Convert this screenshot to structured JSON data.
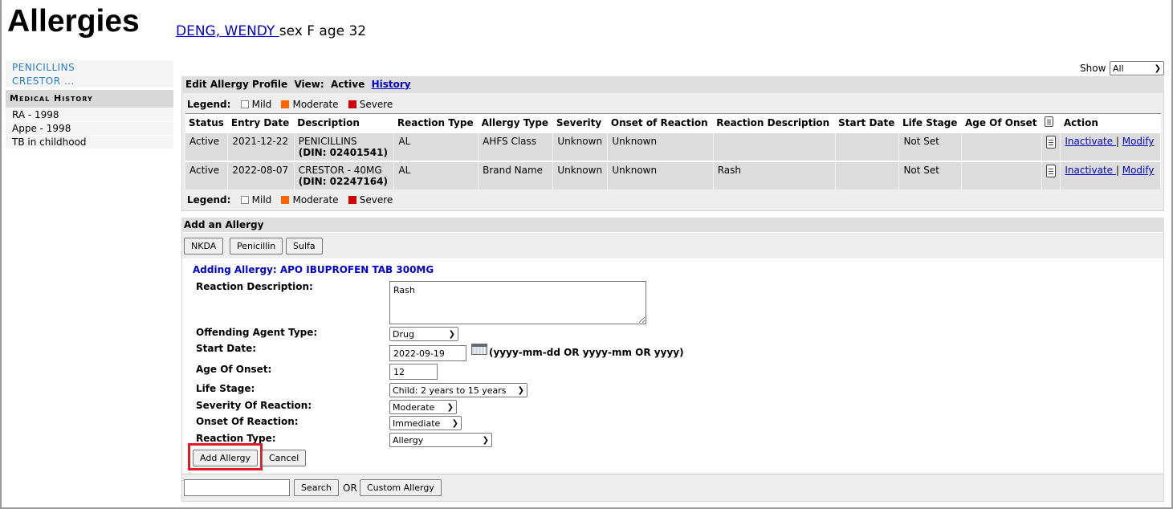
{
  "header": {
    "title": "Allergies",
    "patient_name": "DENG, WENDY ",
    "patient_info": "sex F age 32"
  },
  "sidebar": {
    "allergies": [
      "PENICILLINS",
      "CRESTOR ..."
    ],
    "medical_history_title": "Medical History",
    "medical_history": [
      "RA - 1998",
      "Appe - 1998",
      "TB in childhood"
    ]
  },
  "show": {
    "label": "Show",
    "value": "All"
  },
  "profile": {
    "title": "Edit Allergy Profile",
    "view_label": "View:",
    "view_active": "Active",
    "view_history": "History",
    "legend_label": "Legend:",
    "legend": [
      "Mild",
      "Moderate",
      "Severe"
    ],
    "columns": [
      "Status",
      "Entry Date",
      "Description",
      "Reaction Type",
      "Allergy Type",
      "Severity",
      "Onset of Reaction",
      "Reaction Description",
      "Start Date",
      "Life Stage",
      "Age Of Onset",
      "",
      "Action"
    ],
    "rows": [
      {
        "status": "Active",
        "entry_date": "2021-12-22",
        "description": "PENICILLINS",
        "din": "(DIN: 02401541)",
        "reaction_type": "AL",
        "allergy_type": "AHFS Class",
        "severity": "Unknown",
        "onset": "Unknown",
        "reaction_desc": "",
        "start_date": "",
        "life_stage": "Not Set",
        "age_onset": "",
        "inactivate": "Inactivate ",
        "sep": "|",
        "modify": "Modify"
      },
      {
        "status": "Active",
        "entry_date": "2022-08-07",
        "description": "CRESTOR - 40MG",
        "din": "(DIN: 02247164)",
        "reaction_type": "AL",
        "allergy_type": "Brand Name",
        "severity": "Unknown",
        "onset": "Unknown",
        "reaction_desc": "Rash",
        "start_date": "",
        "life_stage": "Not Set",
        "age_onset": "",
        "inactivate": "Inactivate ",
        "sep": "|",
        "modify": "Modify"
      }
    ]
  },
  "add": {
    "title": "Add an Allergy",
    "quick_buttons": [
      "NKDA",
      "Penicillin",
      "Sulfa"
    ],
    "adding_label": "Adding Allergy: APO IBUPROFEN TAB 300MG",
    "reaction_description_label": "Reaction Description:",
    "reaction_description_value": "Rash",
    "offending_agent_label": "Offending Agent Type:",
    "offending_agent_value": "Drug",
    "start_date_label": "Start Date:",
    "start_date_value": "2022-09-19",
    "date_format_hint": "(yyyy-mm-dd OR yyyy-mm OR yyyy)",
    "age_onset_label": "Age Of Onset:",
    "age_onset_value": "12",
    "life_stage_label": "Life Stage:",
    "life_stage_value": "Child: 2 years to 15 years",
    "severity_label": "Severity Of Reaction:",
    "severity_value": "Moderate",
    "onset_label": "Onset Of Reaction:",
    "onset_value": "Immediate",
    "reaction_type_label": "Reaction Type:",
    "reaction_type_value": "Allergy",
    "add_button": "Add Allergy",
    "cancel_button": "Cancel"
  },
  "search": {
    "value": "",
    "search_button": "Search",
    "or_label": "OR",
    "custom_button": "Custom Allergy"
  },
  "colors": {
    "link": "#0000cc",
    "moderate": "#ff6600",
    "severe": "#cc0000",
    "highlight": "#e01b24"
  }
}
